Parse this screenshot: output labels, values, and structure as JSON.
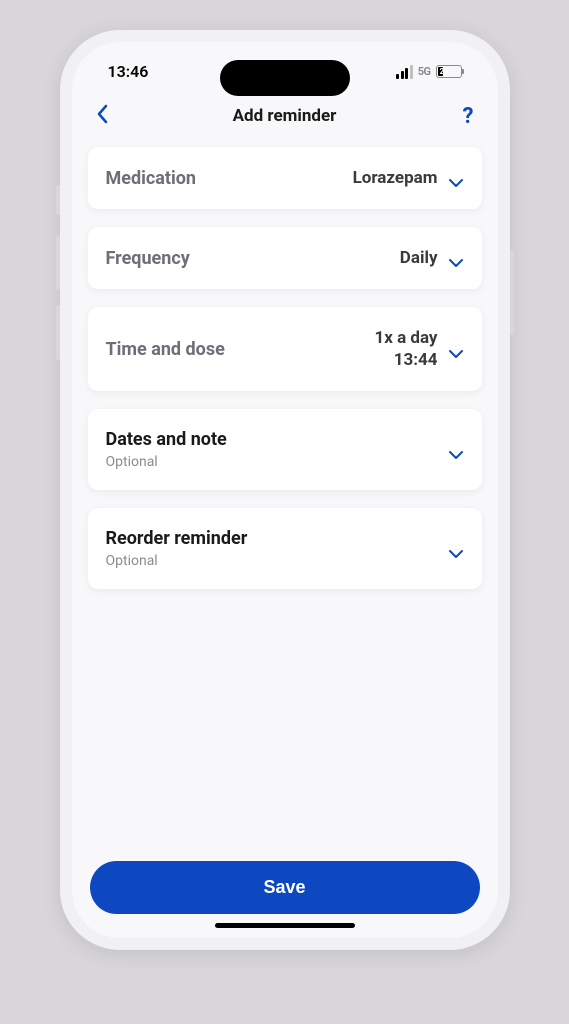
{
  "status": {
    "time": "13:46",
    "network": "5G",
    "battery": "23"
  },
  "header": {
    "title": "Add reminder"
  },
  "cards": {
    "medication": {
      "label": "Medication",
      "value": "Lorazepam"
    },
    "frequency": {
      "label": "Frequency",
      "value": "Daily"
    },
    "timeDose": {
      "label": "Time and dose",
      "line1": "1x a day",
      "line2": "13:44"
    },
    "datesNote": {
      "label": "Dates and note",
      "sublabel": "Optional"
    },
    "reorder": {
      "label": "Reorder reminder",
      "sublabel": "Optional"
    }
  },
  "footer": {
    "saveLabel": "Save"
  }
}
